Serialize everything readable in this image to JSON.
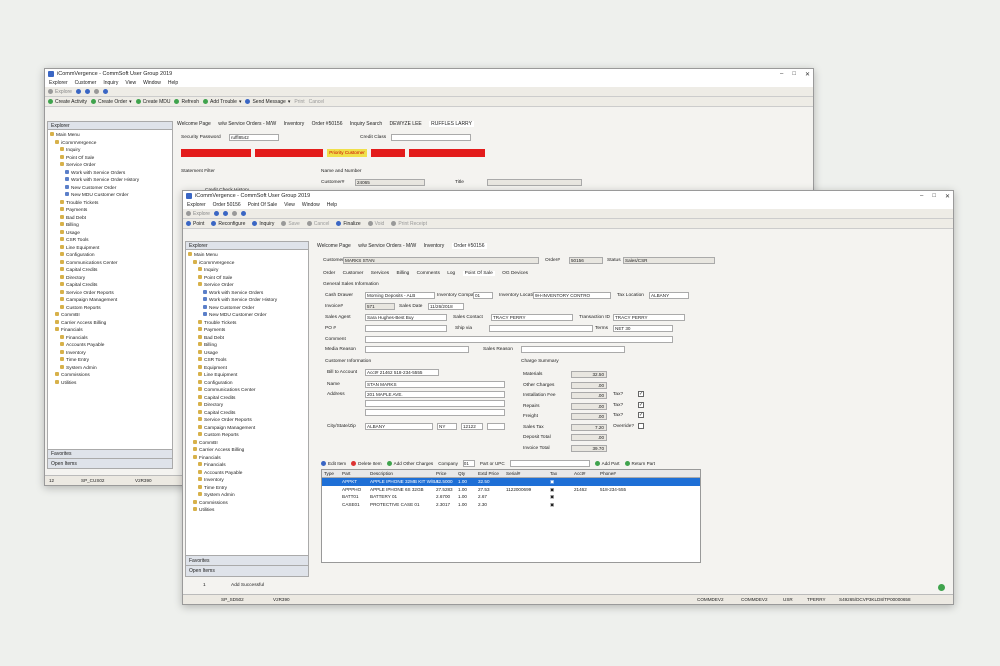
{
  "back": {
    "title": "iCommVergence - CommSoft User Group 2019",
    "menu": [
      "Explorer",
      "Customer",
      "Inquiry",
      "View",
      "Window",
      "Help"
    ],
    "toolbar1": [
      "Explore"
    ],
    "toolbar2": [
      "Create Activity",
      "Create Order",
      "Create MDU",
      "Refresh",
      "Add Trouble",
      "Send Message",
      "Print",
      "Cancel"
    ],
    "tabs": [
      "Welcome Page",
      "w/w Service Orders - M/W",
      "Inventory",
      "Order #50156",
      "Inquiry Search",
      "DEWYZE LEE",
      "RUFFLES LARRY"
    ],
    "explorer": "Explorer",
    "tree": [
      "Main Menu",
      "iCommVergence",
      "Inquiry",
      "Point Of Sale",
      "Service Order",
      "Work with Service Orders",
      "Work with Service Order History",
      "New Customer Order",
      "New MDU Customer Order",
      "Trouble Tickets",
      "Payments",
      "Bad Debt",
      "Billing",
      "Usage",
      "CSR Tools",
      "Line Equipment",
      "Configuration",
      "Communications Center",
      "Capital Credits",
      "Directory",
      "Capital Credits",
      "Service Order Reports",
      "Campaign Management",
      "Custom Reports",
      "CommBI",
      "Carrier Access Billing",
      "Financials",
      "Financials",
      "Accounts Payable",
      "Inventory",
      "Time Entry",
      "System Admin",
      "Commissions",
      "Utilities"
    ],
    "security_label": "Security Password",
    "security_value": "ruffl8542",
    "credit_class": "Credit Class",
    "flags": [
      "Priority Customer"
    ],
    "statement_filter": "Statement Filter",
    "credit_check": "Credit Check History",
    "name_number": "Name and Number",
    "customer_label": "Customer#",
    "customer_value": "24065",
    "title_label": "Title",
    "favorites": "Favorites",
    "open_items": "Open Items",
    "status": [
      "12",
      "SP_CUS02",
      "V2R390"
    ]
  },
  "front": {
    "title": "iCommVergence - CommSoft User Group 2019",
    "menu": [
      "Explorer",
      "Order 50156",
      "Point Of Sale",
      "View",
      "Window",
      "Help"
    ],
    "toolbar1": [
      "Explore"
    ],
    "toolbar2": [
      "Point",
      "Reconfigure",
      "Inquiry",
      "Save",
      "Cancel",
      "Finalize",
      "Void",
      "Print Receipt"
    ],
    "tabs": [
      "Welcome Page",
      "w/w Service Orders - M/W",
      "Inventory",
      "Order #50156"
    ],
    "explorer": "Explorer",
    "tree": [
      "Main Menu",
      "iCommVergence",
      "Inquiry",
      "Point Of Sale",
      "Service Order",
      "Work with Service Orders",
      "Work with Service Order History",
      "New Customer Order",
      "New MDU Customer Order",
      "Trouble Tickets",
      "Payments",
      "Bad Debt",
      "Billing",
      "Usage",
      "CSR Tools",
      "Equipment",
      "Line Equipment",
      "Configuration",
      "Communications Center",
      "Capital Credits",
      "Directory",
      "Capital Credits",
      "Service Order Reports",
      "Campaign Management",
      "Custom Reports",
      "CommBI",
      "Carrier Access Billing",
      "Financials",
      "Financials",
      "Accounts Payable",
      "Inventory",
      "Time Entry",
      "System Admin",
      "Commissions",
      "Utilities"
    ],
    "favorites": "Favorites",
    "open_items": "Open Items",
    "header": {
      "customer_label": "Customer",
      "customer_value": "MARKS STAN",
      "order_label": "Order#",
      "order_value": "50156",
      "status_label": "Status",
      "status_value": "Sales/CSR"
    },
    "subtabs": [
      "Order",
      "Customer",
      "Services",
      "Billing",
      "Comments",
      "Log",
      "Point Of Sale",
      "OG Devices"
    ],
    "general": "General Sales Information",
    "cash_drawer_label": "Cash Drawer",
    "cash_drawer_value": "Morning Deposits - ALB",
    "inv_company_label": "Inventory Company",
    "inv_company_value": "01",
    "inv_location_label": "Inventory Location",
    "inv_location_value": "9H-INVENTORY CONTRO",
    "tax_location_label": "Tax Location",
    "tax_location_value": "ALBANY",
    "invoice_label": "Invoice#",
    "invoice_value": "571",
    "sales_date_label": "Sales Date",
    "sales_date_value": "11/26/2018",
    "sales_agent_label": "Sales Agent",
    "sales_agent_value": "Sara Hughes-Best Buy",
    "sales_contact_label": "Sales Contact",
    "sales_contact_value": "TRACY PERRY",
    "transaction_label": "Transaction ID",
    "transaction_value": "TRACY PERRY",
    "po_label": "PO #",
    "ship_label": "Ship via",
    "terms_label": "Terms",
    "terms_value": "NET 30",
    "comment_label": "Comment",
    "media_label": "Media Reason",
    "sales_reason_label": "Sales Reason",
    "cust_info": "Customer Information",
    "bill_label": "Bill to Account",
    "bill_value": "Acct# 21462  518-234-5555",
    "name_label": "Name",
    "name_value": "STAN MARKS",
    "address_label": "Address",
    "address_value": "201 MAPLE AVE.",
    "city_label": "City/State/Zip",
    "city_value": "ALBANY",
    "state_value": "NY",
    "zip_value": "12122",
    "charge": "Charge Summary",
    "charges": [
      {
        "l": "Materials",
        "v": "32.50"
      },
      {
        "l": "Other Charges",
        "v": ".00"
      },
      {
        "l": "Installation Fee",
        "v": ".00"
      },
      {
        "l": "Repairs",
        "v": ".00"
      },
      {
        "l": "Freight",
        "v": ".00"
      },
      {
        "l": "Sales Tax",
        "v": "7.20"
      },
      {
        "l": "Deposit Total",
        "v": ".00"
      },
      {
        "l": "Invoice Total",
        "v": "39.70"
      }
    ],
    "tax_label": "Tax?",
    "override_label": "Override?",
    "grid_toolbar": [
      "Edit Item",
      "Delete Item",
      "Add Other Charges",
      "Company",
      "01",
      "Part or UPC",
      "Add Part",
      "Return Part"
    ],
    "grid_cols": [
      "Type",
      "Part",
      "Description",
      "Price",
      "Qty",
      "Extd Price",
      "Serial#",
      "Tax",
      "Acct#",
      "Phone#"
    ],
    "rows": [
      {
        "type": "",
        "part": "APPKT",
        "desc": "APPLE IPHONE 32MB KIT W/BA...",
        "price": "32.5000",
        "qty": "1.00",
        "ext": "32.50",
        "serial": "",
        "acct": "",
        "phone": ""
      },
      {
        "type": "",
        "part": "APPPHO",
        "desc": "APPLE IPHONE 6S 32GB",
        "price": "27.5283",
        "qty": "1.00",
        "ext": "27.53",
        "serial": "1122000699",
        "acct": "21462",
        "phone": "518-234-555"
      },
      {
        "type": "",
        "part": "BATT01",
        "desc": "BATTERY 01",
        "price": "2.6700",
        "qty": "1.00",
        "ext": "2.67",
        "serial": "",
        "acct": "",
        "phone": ""
      },
      {
        "type": "",
        "part": "CASE01",
        "desc": "PROTECTIVE CASE 01",
        "price": "2.3017",
        "qty": "1.00",
        "ext": "2.30",
        "serial": "",
        "acct": "",
        "phone": ""
      }
    ],
    "msg_count": "1",
    "msg": "Add Successful",
    "status": [
      "SP_SD502",
      "V2R390",
      "COMMDEV2",
      "COMMDEV2",
      "USR",
      "TPERRY",
      "S49265/DCVP3KLD8/TP00000658"
    ]
  },
  "colors": {
    "red_flag": "#e31b1b",
    "yellow_flag": "#f0e04a",
    "selected_row": "#1e6fd6",
    "header_bg": "#dfe3ea"
  }
}
